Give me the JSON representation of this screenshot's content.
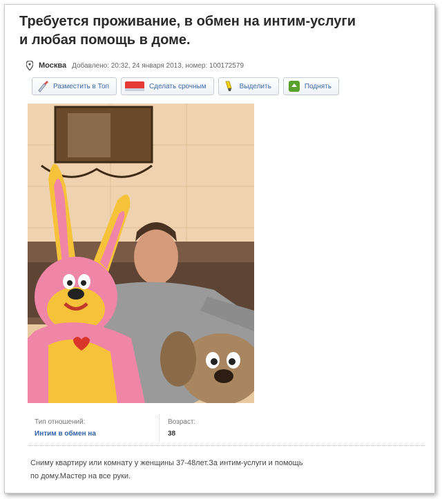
{
  "listing": {
    "title_line1": "Требуется проживание, в обмен на интим-услуги",
    "title_line2": "и любая помощь в доме.",
    "city": "Москва",
    "added": "Добавлено: 20:32, 24 января 2013, номер: 100172579"
  },
  "actions": {
    "top": "Разместить в Топ",
    "urgent": "Сделать срочным",
    "highlight": "Выделить",
    "raise": "Поднять",
    "urgent_badge": "Срочно"
  },
  "details": {
    "relation_label": "Тип отношений:",
    "relation_value": "Интим в обмен на",
    "age_label": "Возраст:",
    "age_value": "38"
  },
  "description": {
    "line1": "Сниму квартиру или комнату у женщины 37-48лет.За интим-услуги и помощь",
    "line2": "по дому.Мастер на все руки."
  },
  "colors": {
    "link": "#2f62a9",
    "accent_green": "#5aa02c"
  }
}
